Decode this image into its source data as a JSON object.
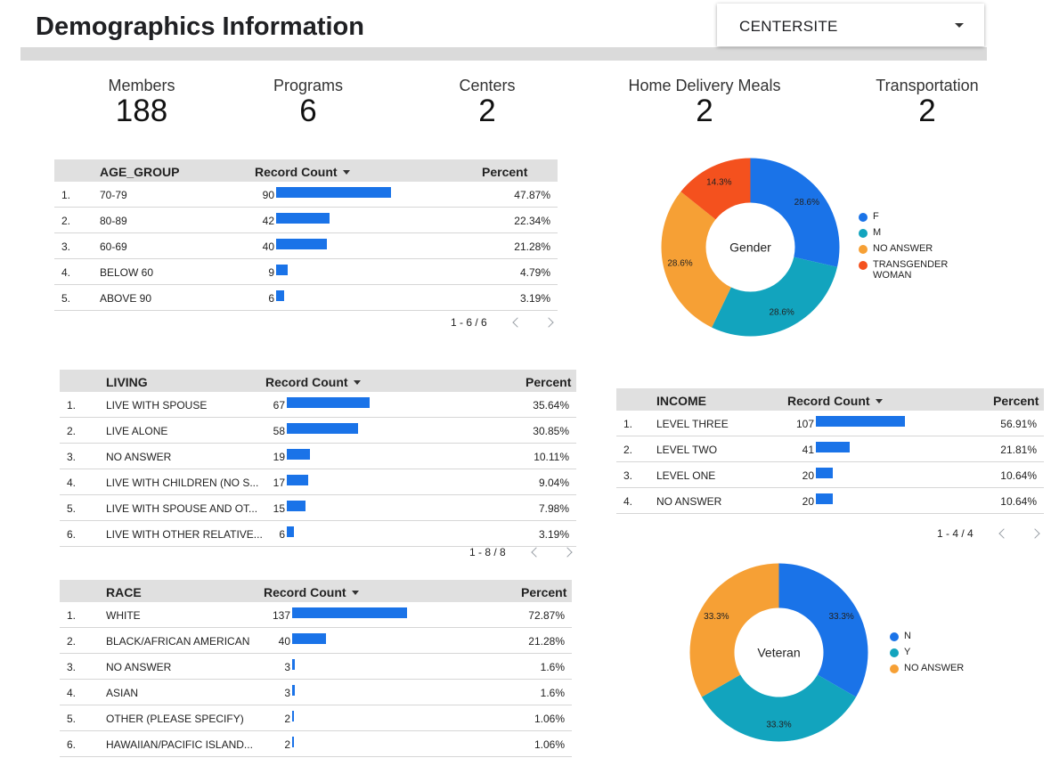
{
  "header": {
    "title": "Demographics Information",
    "dropdown_label": "CENTERSITE"
  },
  "kpis": [
    {
      "label": "Members",
      "value": "188"
    },
    {
      "label": "Programs",
      "value": "6"
    },
    {
      "label": "Centers",
      "value": "2"
    },
    {
      "label": "Home Delivery Meals",
      "value": "2"
    },
    {
      "label": "Transportation",
      "value": "2"
    }
  ],
  "age_table": {
    "dim_header": "AGE_GROUP",
    "count_header": "Record Count",
    "pct_header": "Percent",
    "max": 137,
    "rows": [
      {
        "idx": "1.",
        "label": "70-79",
        "count": 90,
        "pct": "47.87%"
      },
      {
        "idx": "2.",
        "label": "80-89",
        "count": 42,
        "pct": "22.34%"
      },
      {
        "idx": "3.",
        "label": "60-69",
        "count": 40,
        "pct": "21.28%"
      },
      {
        "idx": "4.",
        "label": "BELOW 60",
        "count": 9,
        "pct": "4.79%"
      },
      {
        "idx": "5.",
        "label": "ABOVE 90",
        "count": 6,
        "pct": "3.19%"
      }
    ],
    "pager": "1 - 6 / 6"
  },
  "living_table": {
    "dim_header": "LIVING",
    "count_header": "Record Count",
    "pct_header": "Percent",
    "max": 137,
    "rows": [
      {
        "idx": "1.",
        "label": "LIVE WITH SPOUSE",
        "count": 67,
        "pct": "35.64%"
      },
      {
        "idx": "2.",
        "label": "LIVE ALONE",
        "count": 58,
        "pct": "30.85%"
      },
      {
        "idx": "3.",
        "label": "NO ANSWER",
        "count": 19,
        "pct": "10.11%"
      },
      {
        "idx": "4.",
        "label": "LIVE WITH CHILDREN (NO S...",
        "count": 17,
        "pct": "9.04%"
      },
      {
        "idx": "5.",
        "label": "LIVE WITH SPOUSE AND OT...",
        "count": 15,
        "pct": "7.98%"
      },
      {
        "idx": "6.",
        "label": "LIVE WITH OTHER RELATIVE...",
        "count": 6,
        "pct": "3.19%"
      }
    ],
    "pager": "1 - 8 / 8"
  },
  "race_table": {
    "dim_header": "RACE",
    "count_header": "Record Count",
    "pct_header": "Percent",
    "max": 137,
    "rows": [
      {
        "idx": "1.",
        "label": "WHITE",
        "count": 137,
        "pct": "72.87%"
      },
      {
        "idx": "2.",
        "label": "BLACK/AFRICAN AMERICAN",
        "count": 40,
        "pct": "21.28%"
      },
      {
        "idx": "3.",
        "label": "NO ANSWER",
        "count": 3,
        "pct": "1.6%"
      },
      {
        "idx": "4.",
        "label": "ASIAN",
        "count": 3,
        "pct": "1.6%"
      },
      {
        "idx": "5.",
        "label": "OTHER (PLEASE SPECIFY)",
        "count": 2,
        "pct": "1.06%"
      },
      {
        "idx": "6.",
        "label": "HAWAIIAN/PACIFIC ISLAND...",
        "count": 2,
        "pct": "1.06%"
      }
    ]
  },
  "income_table": {
    "dim_header": "INCOME",
    "count_header": "Record Count",
    "pct_header": "Percent",
    "max": 107,
    "rows": [
      {
        "idx": "1.",
        "label": "LEVEL THREE",
        "count": 107,
        "pct": "56.91%"
      },
      {
        "idx": "2.",
        "label": "LEVEL TWO",
        "count": 41,
        "pct": "21.81%"
      },
      {
        "idx": "3.",
        "label": "LEVEL ONE",
        "count": 20,
        "pct": "10.64%"
      },
      {
        "idx": "4.",
        "label": "NO ANSWER",
        "count": 20,
        "pct": "10.64%"
      }
    ],
    "pager": "1 - 4 / 4"
  },
  "colors": {
    "blue": "#1a73e8",
    "teal": "#12a4be",
    "orange": "#f6a035",
    "red": "#f4511e"
  },
  "chart_data": [
    {
      "type": "pie",
      "title": "Gender",
      "categories": [
        "F",
        "M",
        "NO ANSWER",
        "TRANSGENDER WOMAN"
      ],
      "values": [
        28.6,
        28.6,
        28.6,
        14.3
      ],
      "labels": [
        "28.6%",
        "28.6%",
        "28.6%",
        "14.3%"
      ],
      "colors": [
        "#1a73e8",
        "#12a4be",
        "#f6a035",
        "#f4511e"
      ],
      "legend": "right"
    },
    {
      "type": "pie",
      "title": "Veteran",
      "categories": [
        "N",
        "Y",
        "NO ANSWER"
      ],
      "values": [
        33.3,
        33.3,
        33.3
      ],
      "labels": [
        "33.3%",
        "33.3%",
        "33.3%"
      ],
      "colors": [
        "#1a73e8",
        "#12a4be",
        "#f6a035"
      ],
      "legend": "right"
    }
  ]
}
